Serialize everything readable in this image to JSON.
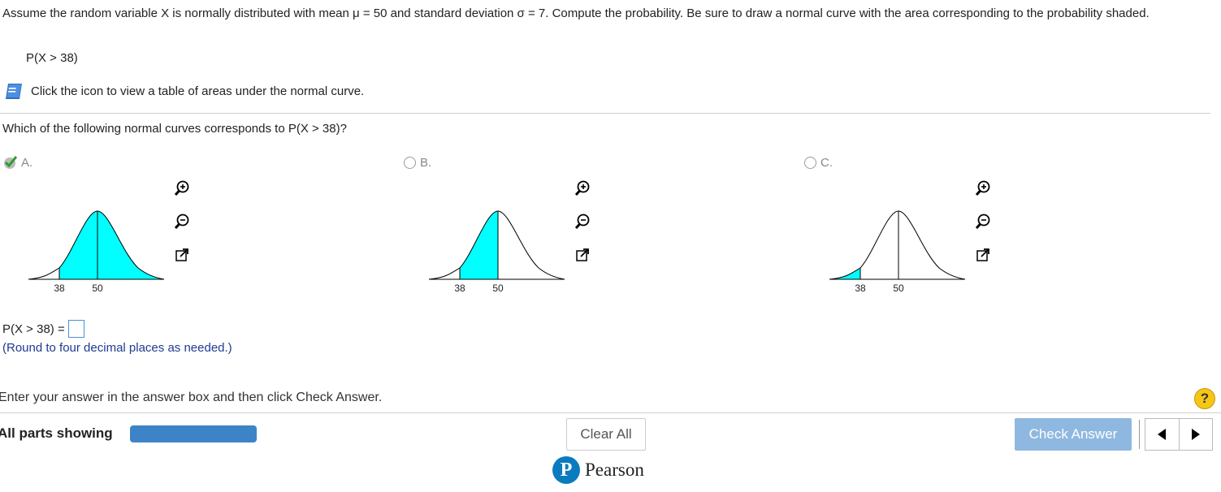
{
  "question": {
    "text": "Assume the random variable X is normally distributed with mean μ = 50 and standard deviation σ = 7. Compute the probability. Be sure to draw a normal curve with the area corresponding to the probability shaded.",
    "probability_expr": "P(X > 38)",
    "table_link": "Click the icon to view a table of areas under the normal curve."
  },
  "part1": {
    "prompt": "Which of the following normal curves corresponds to P(X > 38)?",
    "options": [
      {
        "label": "A.",
        "selected": true,
        "shaded": "right of 38",
        "ticks": [
          "38",
          "50"
        ]
      },
      {
        "label": "B.",
        "selected": false,
        "shaded": "between 38 and 50",
        "ticks": [
          "38",
          "50"
        ]
      },
      {
        "label": "C.",
        "selected": false,
        "shaded": "left of 38",
        "ticks": [
          "38",
          "50"
        ]
      }
    ],
    "icons": [
      "zoom-in-icon",
      "zoom-out-icon",
      "popout-icon"
    ]
  },
  "part2": {
    "answer_label": "P(X > 38) =",
    "answer_value": "",
    "round_hint": "(Round to four decimal places as needed.)"
  },
  "footer": {
    "instruction": "Enter your answer in the answer box and then click Check Answer.",
    "parts_label": "All parts showing",
    "clear_label": "Clear All",
    "check_label": "Check Answer",
    "help_label": "?",
    "brand": "Pearson",
    "brand_logo": "P"
  },
  "colors": {
    "shade": "#00ffff",
    "accent": "#3d84c6",
    "check_button": "#8fb8e0",
    "checkmark": "#2e9e2e"
  }
}
